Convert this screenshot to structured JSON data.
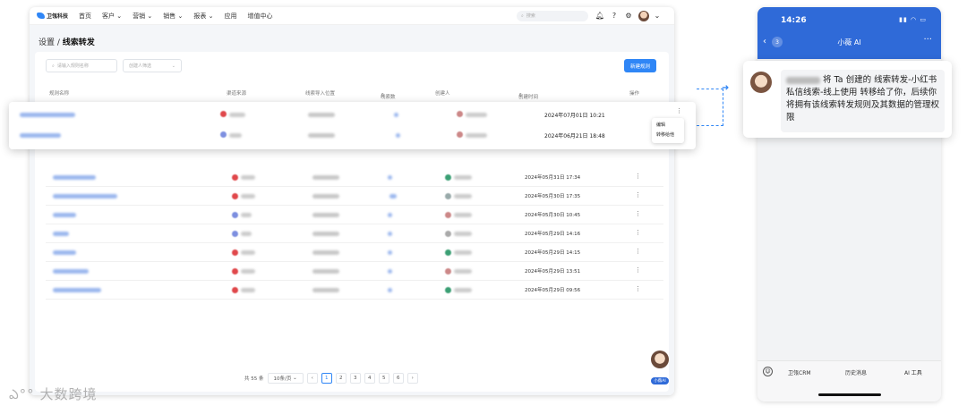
{
  "app": {
    "logo_text": "卫瓴科技",
    "nav": [
      "首页",
      "客户",
      "营销",
      "销售",
      "报表",
      "应用",
      "增值中心"
    ],
    "nav_dropdown": [
      false,
      true,
      true,
      true,
      true,
      false,
      false
    ],
    "search_placeholder": "搜索"
  },
  "page": {
    "breadcrumb_parent": "设置 / ",
    "breadcrumb_current": "线索转发",
    "filter_name_placeholder": "请输入规则名称",
    "filter_creator_placeholder": "创建人筛选",
    "new_button": "新建规则",
    "columns": [
      "规则名称",
      "渠道来源",
      "线索导入位置",
      "线索数",
      "创建人",
      "创建时间",
      "操作"
    ],
    "rows": [
      {
        "date": "2024年05月31日 17:34"
      },
      {
        "date": "2024年05月30日 17:35"
      },
      {
        "date": "2024年05月30日 10:45"
      },
      {
        "date": "2024年05月29日 14:16"
      },
      {
        "date": "2024年05月29日 14:15"
      },
      {
        "date": "2024年05月29日 13:51"
      },
      {
        "date": "2024年05月29日 09:56"
      }
    ],
    "highlight_rows": [
      {
        "date": "2024年07月01日 10:21"
      },
      {
        "date": "2024年06月21日 18:48"
      }
    ],
    "row_menu": [
      "编辑",
      "转移给他"
    ],
    "total": "共 55 条",
    "page_size": "10条/页",
    "pages": [
      "1",
      "2",
      "3",
      "4",
      "5",
      "6"
    ],
    "active_page": "1",
    "mini_ai_label": "小薇AI"
  },
  "phone": {
    "time": "14:26",
    "back_count": "3",
    "title": "小薇 AI",
    "message": "将 Ta 创建的 线索转发-小红书私信线索-线上使用 转移给了你，后续你将拥有该线索转发规则及其数据的管理权限",
    "footer": [
      "卫瓴CRM",
      "历史消息",
      "AI 工具"
    ]
  },
  "watermark": "大数跨境",
  "colors": {
    "primary": "#2f86f6",
    "phone_header": "#2f6ad8"
  }
}
